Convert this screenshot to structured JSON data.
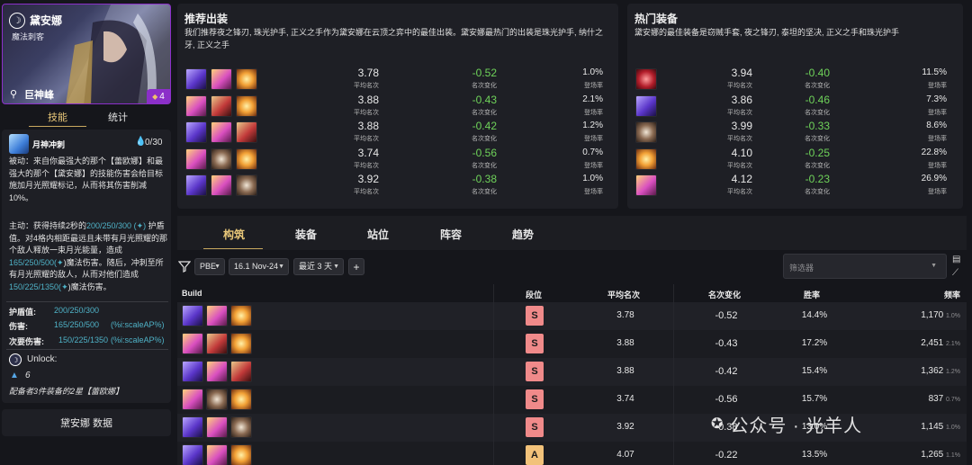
{
  "champion": {
    "name": "黛安娜",
    "class": "魔法刺客",
    "origin": "巨神峰",
    "cost": "4",
    "colors": {
      "cost_border": "#8b2fc9"
    }
  },
  "skill_tabs": {
    "skill": "技能",
    "stats": "统计"
  },
  "skill": {
    "name": "月神冲刺",
    "mana": "0/30",
    "passive": "被动：来自你最强大的那个【蕾欧娜】和最强大的那个【黛安娜】的技能伤害会给目标施加月光照耀标记，从而将其伤害削减10%。",
    "active_prefix": "主动：获得持续2秒的",
    "active_v1": "200/250/300",
    "active_mid1": "护盾值。对4格内相距最远且未带有月光照耀的那个敌人释放一束月光能量，造成",
    "active_v2": "165/250/500(",
    "active_mid2": ")魔法伤害。随后，冲刺至所有月光照耀的敌人，从而对他们造成",
    "active_v3": "150/225/1350(",
    "active_end": ")魔法伤害。",
    "stats": [
      {
        "label": "护盾值:",
        "value": "200/250/300",
        "extra": ""
      },
      {
        "label": "伤害:",
        "value": "165/250/500",
        "extra": "(%i:scaleAP%)"
      },
      {
        "label": "次要伤害:",
        "value": "150/225/1350",
        "extra": "(%i:scaleAP%)"
      }
    ],
    "unlock_label": "Unlock:",
    "unlock_count": "6",
    "unlock_desc": "配备者3件装备的2星【蕾欧娜】"
  },
  "data_button": "黛安娜 数据",
  "recommended": {
    "title": "推荐出装",
    "desc": "我们推荐夜之锋刃, 珠光护手, 正义之手作为黛安娜在云顶之弈中的最佳出装。黛安娜最热门的出装是珠光护手, 纳什之牙, 正义之手",
    "rows": [
      {
        "items": [
          "ie",
          "jg",
          "hoj"
        ],
        "avg": "3.78",
        "change": "-0.52",
        "pick": "1.0%"
      },
      {
        "items": [
          "jg",
          "ns",
          "hoj"
        ],
        "avg": "3.88",
        "change": "-0.43",
        "pick": "2.1%"
      },
      {
        "items": [
          "ie",
          "jg",
          "ns"
        ],
        "avg": "3.88",
        "change": "-0.42",
        "pick": "1.2%"
      },
      {
        "items": [
          "jg",
          "gs",
          "hoj"
        ],
        "avg": "3.74",
        "change": "-0.56",
        "pick": "0.7%"
      },
      {
        "items": [
          "ie",
          "jg",
          "gs"
        ],
        "avg": "3.92",
        "change": "-0.38",
        "pick": "1.0%"
      }
    ]
  },
  "hot": {
    "title": "热门装备",
    "desc": "黛安娜的最佳装备是窃贼手套, 夜之锋刃, 泰坦的坚决, 正义之手和珠光护手",
    "rows": [
      {
        "item": "tg",
        "avg": "3.94",
        "change": "-0.40",
        "pick": "11.5%"
      },
      {
        "item": "ie",
        "avg": "3.86",
        "change": "-0.46",
        "pick": "7.3%"
      },
      {
        "item": "gs",
        "avg": "3.99",
        "change": "-0.33",
        "pick": "8.6%"
      },
      {
        "item": "hoj",
        "avg": "4.10",
        "change": "-0.25",
        "pick": "22.8%"
      },
      {
        "item": "jg",
        "avg": "4.12",
        "change": "-0.23",
        "pick": "26.9%"
      }
    ]
  },
  "labels": {
    "avg": "平均名次",
    "change": "名次变化",
    "pick": "登场率"
  },
  "tabs": [
    "构筑",
    "装备",
    "站位",
    "阵容",
    "趋势"
  ],
  "filters": {
    "set": "PBE",
    "patch": "16.1 Nov-24",
    "days": "最近 3 天",
    "add": "+",
    "placeholder": "筛选器"
  },
  "table": {
    "headers": {
      "build": "Build",
      "tier": "段位",
      "avg": "平均名次",
      "change": "名次变化",
      "win": "胜率",
      "freq": "频率"
    },
    "rows": [
      {
        "items": [
          "ie",
          "jg",
          "hoj"
        ],
        "tier": "S",
        "avg": "3.78",
        "change": "-0.52",
        "win": "14.4%",
        "count": "1,170",
        "pct": "1.0%"
      },
      {
        "items": [
          "jg",
          "ns",
          "hoj"
        ],
        "tier": "S",
        "avg": "3.88",
        "change": "-0.43",
        "win": "17.2%",
        "count": "2,451",
        "pct": "2.1%"
      },
      {
        "items": [
          "ie",
          "jg",
          "ns"
        ],
        "tier": "S",
        "avg": "3.88",
        "change": "-0.42",
        "win": "15.4%",
        "count": "1,362",
        "pct": "1.2%"
      },
      {
        "items": [
          "jg",
          "gs",
          "hoj"
        ],
        "tier": "S",
        "avg": "3.74",
        "change": "-0.56",
        "win": "15.7%",
        "count": "837",
        "pct": "0.7%"
      },
      {
        "items": [
          "ie",
          "jg",
          "gs"
        ],
        "tier": "S",
        "avg": "3.92",
        "change": "-0.38",
        "win": "13.0%",
        "count": "1,145",
        "pct": "1.0%"
      },
      {
        "items": [
          "ie",
          "jg",
          "hoj"
        ],
        "tier": "A",
        "avg": "4.07",
        "change": "-0.22",
        "win": "13.5%",
        "count": "1,265",
        "pct": "1.1%"
      }
    ],
    "tier_colors": {
      "S": "#f08a8a",
      "A": "#f2c27a"
    }
  },
  "watermark": "公众号 · 光羊人"
}
